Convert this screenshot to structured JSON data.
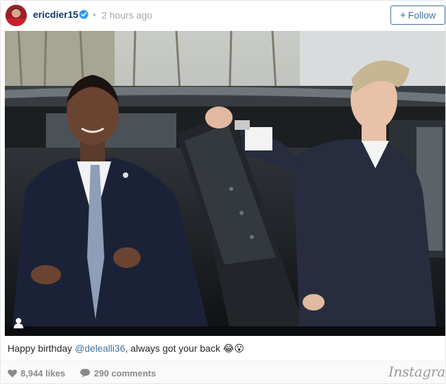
{
  "post": {
    "username": "ericdier15",
    "separator": "•",
    "time": "2 hours ago",
    "follow_label": "Follow",
    "follow_plus": "+"
  },
  "caption": {
    "text_before": "Happy birthday ",
    "mention": "@delealli36",
    "text_after": ", always got your back 😂😮"
  },
  "footer": {
    "likes": "8,944 likes",
    "comments": "290 comments",
    "brand": "Instagram"
  },
  "icons": {
    "verified": "verified-badge-icon",
    "user_tag": "user-tag-icon",
    "likes": "heart-icon",
    "comments": "comment-bubble-icon"
  },
  "colors": {
    "username": "#12376a",
    "accent": "#3f729b",
    "muted": "#a5a7aa",
    "verified": "#3897f0"
  }
}
